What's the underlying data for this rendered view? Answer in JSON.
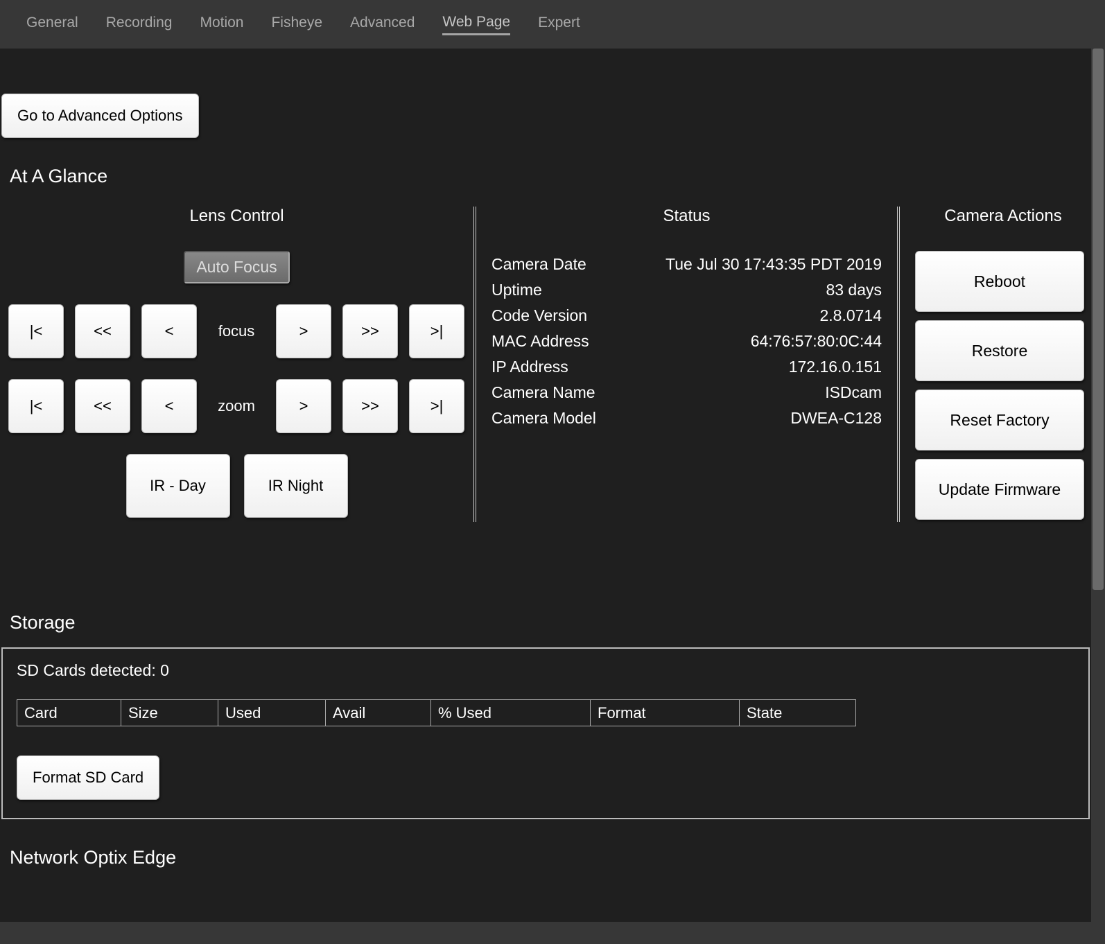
{
  "tabs": {
    "items": [
      {
        "label": "General"
      },
      {
        "label": "Recording"
      },
      {
        "label": "Motion"
      },
      {
        "label": "Fisheye"
      },
      {
        "label": "Advanced"
      },
      {
        "label": "Web Page"
      },
      {
        "label": "Expert"
      }
    ],
    "active_index": 5
  },
  "advanced_button": "Go to Advanced Options",
  "glance": {
    "title": "At A Glance",
    "lens": {
      "title": "Lens Control",
      "autofocus": "Auto Focus",
      "focus_label": "focus",
      "zoom_label": "zoom",
      "first": "|<",
      "prev_fast": "<<",
      "prev": "<",
      "next": ">",
      "next_fast": ">>",
      "last": ">|",
      "ir_day": "IR - Day",
      "ir_night": "IR Night"
    },
    "status": {
      "title": "Status",
      "rows": [
        {
          "k": "Camera Date",
          "v": "Tue Jul 30 17:43:35 PDT 2019"
        },
        {
          "k": "Uptime",
          "v": "83 days"
        },
        {
          "k": "Code Version",
          "v": "2.8.0714"
        },
        {
          "k": "MAC Address",
          "v": "64:76:57:80:0C:44"
        },
        {
          "k": "IP Address",
          "v": "172.16.0.151"
        },
        {
          "k": "Camera Name",
          "v": "ISDcam"
        },
        {
          "k": "Camera Model",
          "v": "DWEA-C128"
        }
      ]
    },
    "actions": {
      "title": "Camera Actions",
      "reboot": "Reboot",
      "restore": "Restore",
      "reset_factory": "Reset Factory",
      "update_firmware": "Update Firmware"
    }
  },
  "storage": {
    "title": "Storage",
    "detected_label": "SD Cards detected: ",
    "detected_count": "0",
    "headers": {
      "card": "Card",
      "size": "Size",
      "used": "Used",
      "avail": "Avail",
      "pct": "% Used",
      "format": "Format",
      "state": "State"
    },
    "format_button": "Format SD Card"
  },
  "nx": {
    "title": "Network Optix Edge"
  }
}
